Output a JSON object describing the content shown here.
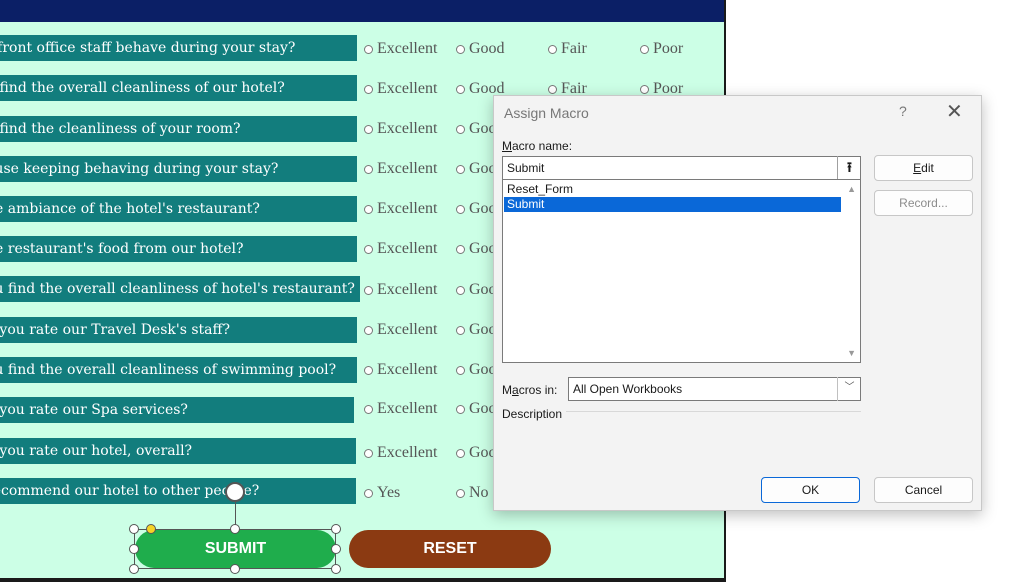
{
  "questions": [
    "How would you rate how our front office staff behave during your stay?",
    "How do you find the overall cleanliness of our hotel?",
    "How do you find the cleanliness of your room?",
    "How was our house keeping behaving during your stay?",
    "How was the ambiance of the hotel's restaurant?",
    "How did you find the restaurant's food from our hotel?",
    "How do you find the overall cleanliness of hotel's restaurant?",
    "How would you rate our Travel Desk's staff?",
    "How do you find the overall cleanliness of swimming pool?",
    "How would you rate our Spa services?",
    "How would you rate our hotel, overall?",
    "Would you recommend our hotel to other people?"
  ],
  "questions_visible": [
    "r front office staff behave during your stay?",
    "u find the overall cleanliness of our hotel?",
    "u find the cleanliness of your room?",
    "ouse keeping behaving during your stay?",
    "he ambiance of the hotel's restaurant?",
    "he restaurant's food from our hotel?",
    "ou find the overall cleanliness of hotel's restaurant?",
    "d you rate our Travel Desk's staff?",
    "ou find the overall cleanliness of swimming pool?",
    "d you rate our Spa services?",
    "d you rate our hotel, overall?",
    " recommend our hotel to other people?"
  ],
  "options": {
    "excellent": "Excellent",
    "good": "Good",
    "good_clipped": "Goo",
    "fair": "Fair",
    "poor": "Poor",
    "yes": "Yes",
    "no": "No"
  },
  "buttons": {
    "submit": "SUBMIT",
    "reset": "RESET"
  },
  "dialog": {
    "title": "Assign Macro",
    "help": "?",
    "close": "✕",
    "macro_name_label_u": "M",
    "macro_name_label_rest": "acro name:",
    "macro_name_value": "Submit",
    "macros": [
      "Reset_Form",
      "Submit"
    ],
    "selected_macro": "Submit",
    "edit_u": "E",
    "edit_rest": "dit",
    "record_label": "Record...",
    "macros_in_label_a": "M",
    "macros_in_label_u": "a",
    "macros_in_label_rest": "cros in:",
    "macros_in_value": "All Open Workbooks",
    "description_label": "Description",
    "ok_label": "OK",
    "cancel_label": "Cancel"
  },
  "colors": {
    "header": "#0b1f66",
    "sheet_bg": "#ccffe6",
    "question_bg": "#127d7d",
    "submit_bg": "#1fad4c",
    "reset_bg": "#8b3a12",
    "selection": "#0a68d8"
  }
}
